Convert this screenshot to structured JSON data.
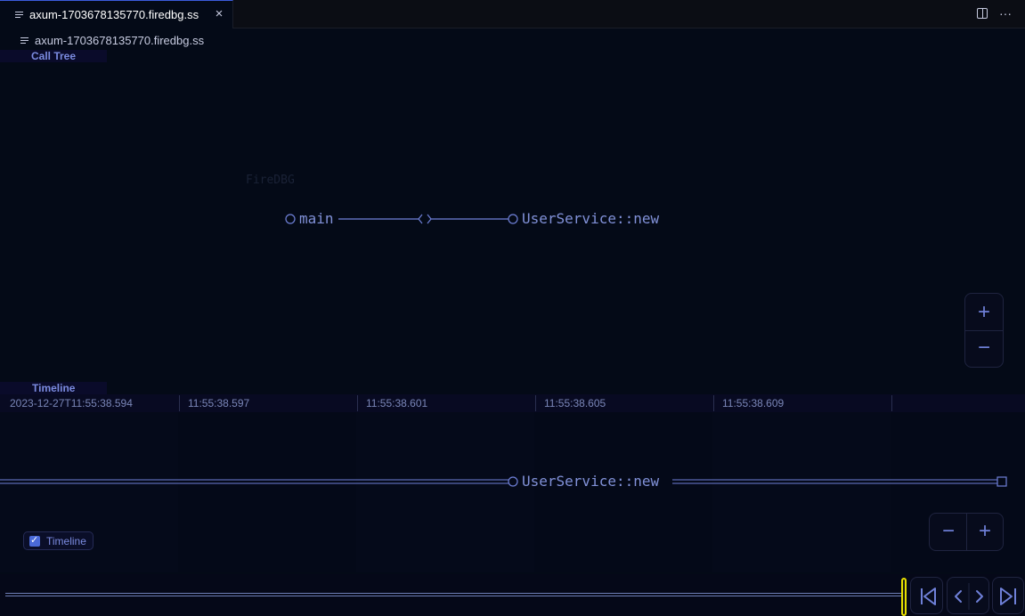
{
  "tab": {
    "label": "axum-1703678135770.firedbg.ss",
    "close_glyph": "×"
  },
  "toolbar": {
    "more_glyph": "···"
  },
  "breadcrumb": {
    "label": "axum-1703678135770.firedbg.ss"
  },
  "call_tree": {
    "header": "Call Tree",
    "watermark": "FireDBG",
    "nodes": [
      {
        "label": "main"
      },
      {
        "label": "UserService::new"
      }
    ],
    "zoom_in_glyph": "+",
    "zoom_out_glyph": "−"
  },
  "timeline": {
    "header": "Timeline",
    "ticks": [
      "2023-12-27T11:55:38.594",
      "11:55:38.597",
      "11:55:38.601",
      "11:55:38.605",
      "11:55:38.609"
    ],
    "event_label": "UserService::new",
    "toggle_label": "Timeline",
    "toggle_checked": true,
    "zoom_out_glyph": "−",
    "zoom_in_glyph": "+"
  },
  "colors": {
    "accent": "#6f80d8",
    "node_text": "#8191d8",
    "handle": "#e8e000",
    "background": "#040a17"
  }
}
